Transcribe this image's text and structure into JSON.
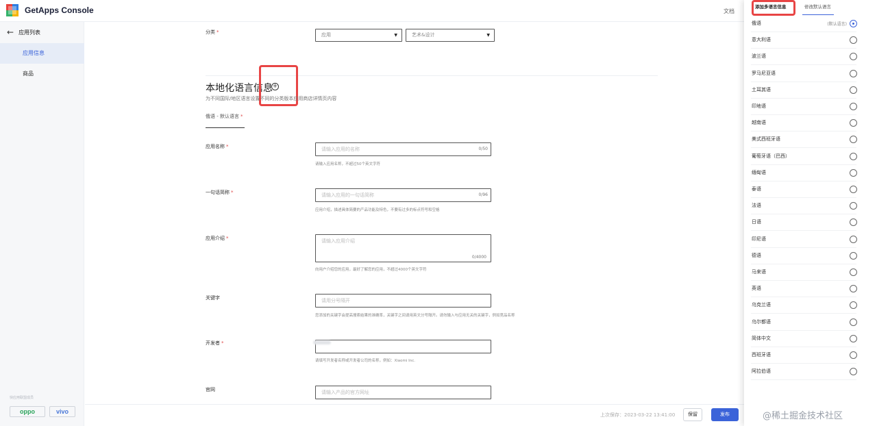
{
  "header": {
    "title": "GetApps Console",
    "doc_link": "文档"
  },
  "sidebar": {
    "back_label": "应用列表",
    "items": [
      {
        "label": "应用信息",
        "active": true
      },
      {
        "label": "商品",
        "active": false
      }
    ],
    "partner_label": "快应用联盟成员",
    "partners": [
      "oppo",
      "vivo"
    ]
  },
  "form": {
    "category": {
      "label": "分类",
      "select1": "应用",
      "select2": "艺术&设计"
    },
    "localization": {
      "title": "本地化语言信息",
      "desc": "为不同国际/地区语言设置不同的分类版本应用商店详情页内容",
      "tab": "俄语 - 默认语言"
    },
    "app_name": {
      "label": "应用名称",
      "placeholder": "请输入应用的名称",
      "count": "0/50",
      "hint": "请输入应用名称，不超过50个英文字符"
    },
    "tagline": {
      "label": "一句话简称",
      "placeholder": "请输入应用的一句话简称",
      "count": "0/96",
      "hint": "应用介绍，描述具体简要的产品功能及特色，不要有过多的标点符号和空格"
    },
    "intro": {
      "label": "应用介绍",
      "placeholder": "请输入应用介绍",
      "count": "0/4000",
      "hint": "向用户介绍您的应用，最好了解您的应用，不超过4000个英文字符"
    },
    "keywords": {
      "label": "关键字",
      "placeholder": "请用分号隔开",
      "hint": "您添加的关键字会提高搜索结果的准确率，关键字之间请用英文分号隔开。请勿输入与应用无关的关键字，例如竞品名称"
    },
    "developer": {
      "label": "开发者",
      "hint": "请填写开发者名称或开发者公司的名称，例如：Xiaomi Inc."
    },
    "website": {
      "label": "官网",
      "placeholder": "请输入产品的官方网址"
    }
  },
  "footer": {
    "saved_time": "上次保存：2023-03-22 13:41:00",
    "save_label": "保留",
    "publish_label": "发布"
  },
  "panel": {
    "tab_add": "添加多语言信息",
    "tab_change": "修改默认语言",
    "default_tag": "(默认语言)",
    "languages": [
      {
        "name": "俄语",
        "default": true
      },
      {
        "name": "意大利语"
      },
      {
        "name": "波兰语"
      },
      {
        "name": "罗马尼亚语"
      },
      {
        "name": "土耳其语"
      },
      {
        "name": "印地语"
      },
      {
        "name": "越南语"
      },
      {
        "name": "美式西班牙语"
      },
      {
        "name": "葡萄牙语（巴西）"
      },
      {
        "name": "缅甸语"
      },
      {
        "name": "泰语"
      },
      {
        "name": "法语"
      },
      {
        "name": "日语"
      },
      {
        "name": "印尼语"
      },
      {
        "name": "德语"
      },
      {
        "name": "马来语"
      },
      {
        "name": "英语"
      },
      {
        "name": "乌克兰语"
      },
      {
        "name": "乌尔都语"
      },
      {
        "name": "简体中文"
      },
      {
        "name": "西班牙语"
      },
      {
        "name": "阿拉伯语"
      }
    ]
  },
  "watermark": "@稀土掘金技术社区",
  "colors": {
    "accent": "#3b63d9",
    "highlight": "#e84545",
    "required": "#e04848"
  },
  "icons": [
    "app-logo-icon",
    "arrow-left-icon",
    "add-circle-icon",
    "chevron-down-icon",
    "radio-icon"
  ]
}
